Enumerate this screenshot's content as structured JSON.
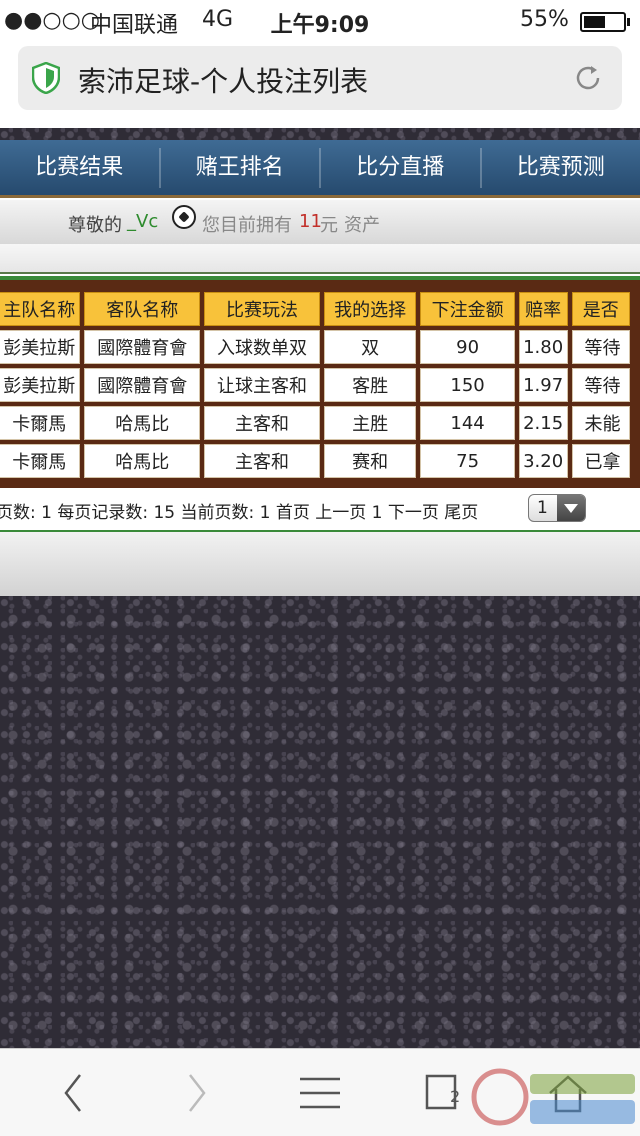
{
  "status_bar": {
    "signal": "●●○○○",
    "carrier": "中国联通",
    "network": "4G",
    "time": "上午9:09",
    "battery_percent": "55%",
    "battery_level": 0.55
  },
  "url_bar": {
    "title": "索沛足球-个人投注列表",
    "shield_icon": "shield-icon",
    "reload_icon": "reload-icon"
  },
  "nav": {
    "items": [
      "比赛结果",
      "赌王排名",
      "比分直播",
      "比赛预测"
    ]
  },
  "greeting": {
    "prefix": "尊敬的",
    "username": "_Vc",
    "text": "您目前拥有",
    "amount": "11",
    "unit": "元",
    "suffix": "资产"
  },
  "table": {
    "headers": [
      "主队名称",
      "客队名称",
      "比赛玩法",
      "我的选择",
      "下注金额",
      "赔率",
      "是否"
    ],
    "rows": [
      [
        "彭美拉斯",
        "國際體育會",
        "入球数单双",
        "双",
        "90",
        "1.80",
        "等待"
      ],
      [
        "彭美拉斯",
        "國際體育會",
        "让球主客和",
        "客胜",
        "150",
        "1.97",
        "等待"
      ],
      [
        "卡爾馬",
        "哈馬比",
        "主客和",
        "主胜",
        "144",
        "2.15",
        "未能"
      ],
      [
        "卡爾馬",
        "哈馬比",
        "主客和",
        "赛和",
        "75",
        "3.20",
        "已拿"
      ]
    ],
    "status_colors": {
      "等待": "#333333",
      "未能": "#999999",
      "已拿": "#2e8b2e"
    },
    "odds_color": "#2a55a8"
  },
  "pager": {
    "text": "页数: 1 每页记录数: 15 当前页数: 1 首页 上一页 1 下一页 尾页",
    "selected_page": "1"
  },
  "toolbar": {
    "tab_count": "2",
    "icons": [
      "back-icon",
      "forward-icon",
      "menu-icon",
      "tabs-icon",
      "home-icon"
    ]
  },
  "colors": {
    "nav_bg": "#2f5a82",
    "header_bg": "#f8c23a",
    "table_frame": "#5a2a14",
    "accent_green": "#3a8a3a",
    "asset_red": "#c2302a"
  }
}
